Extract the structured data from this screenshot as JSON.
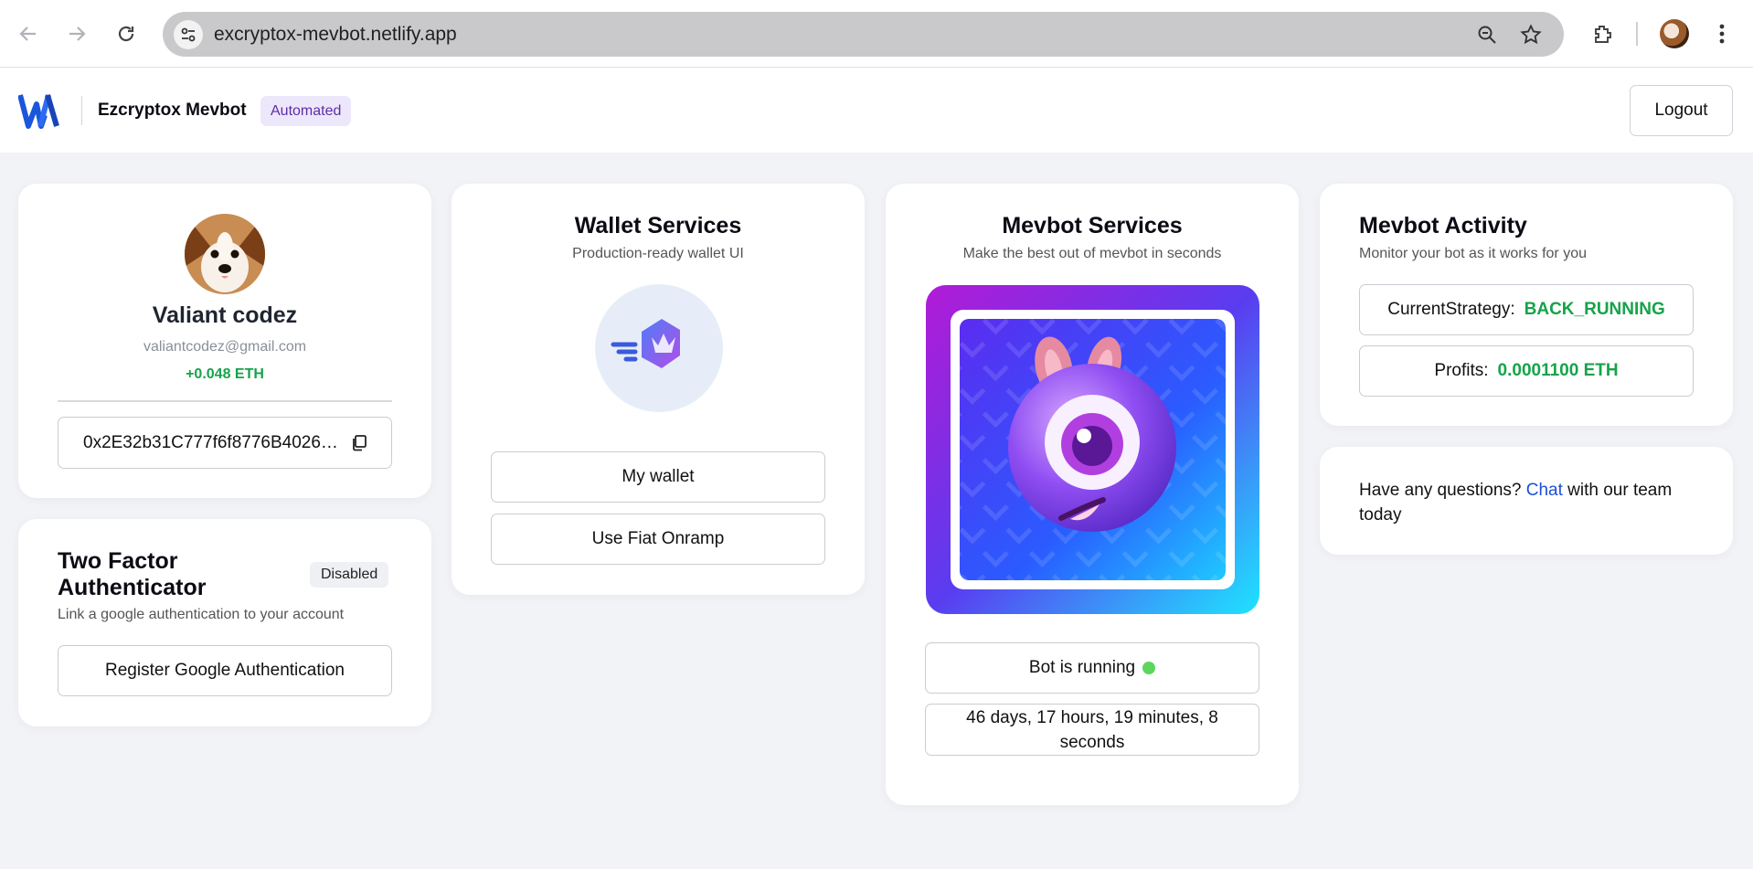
{
  "browser": {
    "url": "excryptox-mevbot.netlify.app",
    "icons": [
      "back-icon",
      "forward-icon",
      "reload-icon",
      "site-settings-icon",
      "zoom-icon",
      "bookmark-star-icon",
      "extensions-icon",
      "profile-avatar",
      "menu-kebab-icon"
    ]
  },
  "header": {
    "brand": "Ezcryptox Mevbot",
    "badge": "Automated",
    "logout_label": "Logout"
  },
  "profile": {
    "name": "Valiant codez",
    "email": "valiantcodez@gmail.com",
    "balance": "+0.048 ETH",
    "address": "0x2E32b31C777f6f8776B4026…"
  },
  "two_factor": {
    "title_line1": "Two Factor",
    "title_line2": "Authenticator",
    "status": "Disabled",
    "description": "Link a google authentication to your account",
    "register_label": "Register Google Authentication"
  },
  "wallet": {
    "title": "Wallet Services",
    "subtitle": "Production-ready wallet UI",
    "my_wallet_label": "My wallet",
    "fiat_label": "Use Fiat Onramp"
  },
  "mevbot_services": {
    "title": "Mevbot Services",
    "subtitle": "Make the best out of mevbot in seconds",
    "status_label": "Bot is running",
    "uptime": "46 days, 17 hours, 19 minutes, 8 seconds"
  },
  "activity": {
    "title": "Mevbot Activity",
    "subtitle": "Monitor your bot as it works for you",
    "strategy_label": "CurrentStrategy:",
    "strategy_value": "BACK_RUNNING",
    "profits_label": "Profits:",
    "profits_value": "0.0001100 ETH"
  },
  "support": {
    "text_before": "Have any questions?",
    "link": "Chat",
    "text_after": "with our team today"
  },
  "colors": {
    "accent_green": "#16a34a",
    "link_blue": "#1d4ed8",
    "badge_purple": "#5a2fa8",
    "logo_blue": "#1a56db"
  }
}
